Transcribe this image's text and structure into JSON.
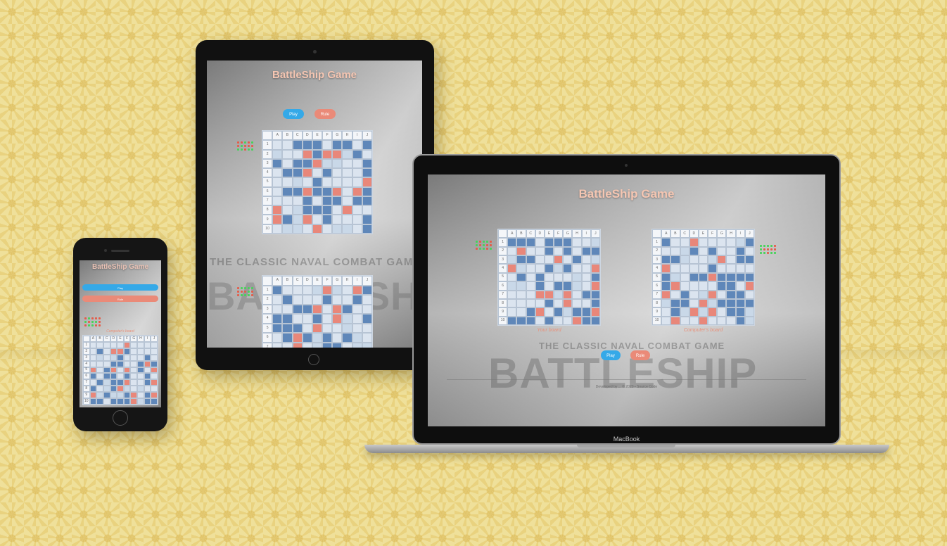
{
  "app": {
    "title": "BattleShip Game"
  },
  "buttons": {
    "play_label": "Play",
    "rule_label": "Rule"
  },
  "boards": {
    "your_board": "Your board",
    "computer_board": "Computer's board"
  },
  "watermark": {
    "subtitle": "THE CLASSIC NAVAL COMBAT GAME",
    "logo": "BATTLESHIP"
  },
  "footer": {
    "text": "Developed by ... © 2020 • Source Code"
  },
  "laptop": {
    "brand": "MacBook"
  },
  "grid": {
    "columns": [
      "A",
      "B",
      "C",
      "D",
      "E",
      "F",
      "G",
      "H",
      "I",
      "J"
    ],
    "rows": [
      "1",
      "2",
      "3",
      "4",
      "5",
      "6",
      "7",
      "8",
      "9",
      "10"
    ]
  },
  "colors": {
    "accent": "#f5c6b2",
    "play": "#35a9e8",
    "rule": "#ea8a78",
    "ship": "#5f87b9",
    "hit": "#e8877a",
    "water": "#dbe4ef"
  }
}
